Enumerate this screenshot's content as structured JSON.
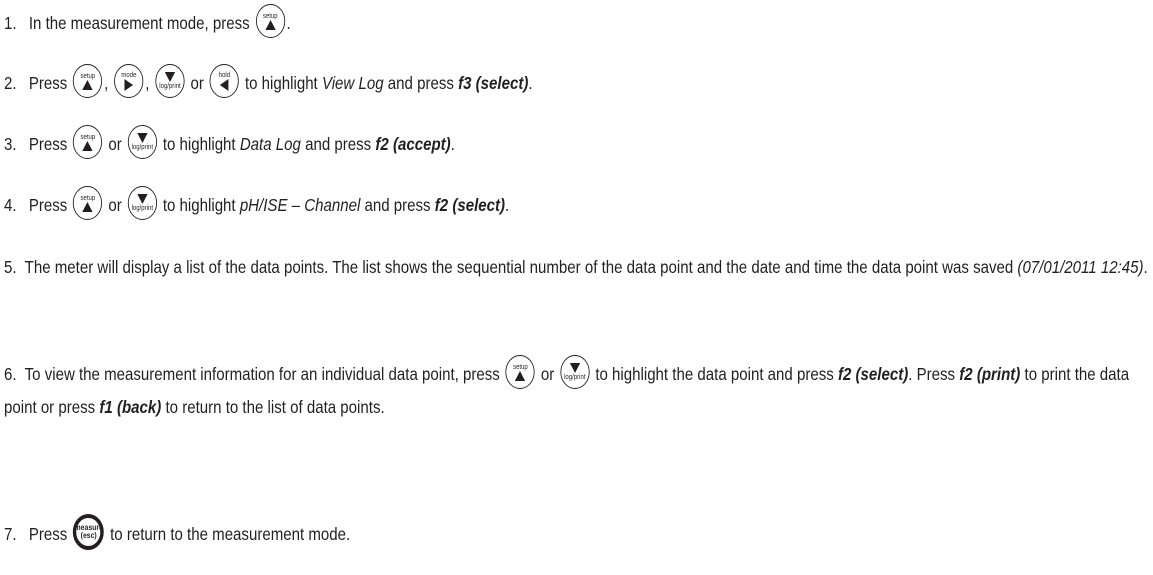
{
  "steps": [
    {
      "number": "1.",
      "t1": "In the measurement mode, press",
      "t2": "."
    },
    {
      "number": "2.",
      "t1": "Press",
      "c1": ",",
      "c2": ",",
      "or": "or",
      "t2": "to highlight",
      "item": "View Log",
      "t3": "and press",
      "key": "f3 (select)",
      "end": "."
    },
    {
      "number": "3.",
      "t1": "Press",
      "or": "or",
      "t2": "to highlight",
      "item": "Data Log",
      "t3": "and press",
      "key": "f2 (accept)",
      "end": "."
    },
    {
      "number": "4.",
      "t1": "Press",
      "or": "or",
      "t2": "to highlight",
      "item": "pH/ISE – Channel",
      "t3": "and press",
      "key": "f2 (select)",
      "end": "."
    },
    {
      "number": "5.",
      "t1": "The meter will display a list of the data points. The list shows the sequential number of the data point and the date and time the data point was saved",
      "example": "(07/01/2011 12:45)",
      "end": "."
    },
    {
      "number": "6.",
      "t1": "To view the measurement information for an individual data point, press",
      "or": "or",
      "t2": "to highlight the data point and press",
      "key1": "f2 (select)",
      "t3": ". Press",
      "key2": "f2 (print)",
      "t4": "to print the data point or press",
      "key3": "f1 (back)",
      "t5": "to return to the list of data points."
    },
    {
      "number": "7.",
      "t1": "Press",
      "t2": "to return to the measurement mode."
    }
  ],
  "buttons": {
    "setup": "setup",
    "mode": "mode",
    "log_print": "log/print",
    "hold": "hold",
    "measure": "measure",
    "esc": "(esc)"
  }
}
